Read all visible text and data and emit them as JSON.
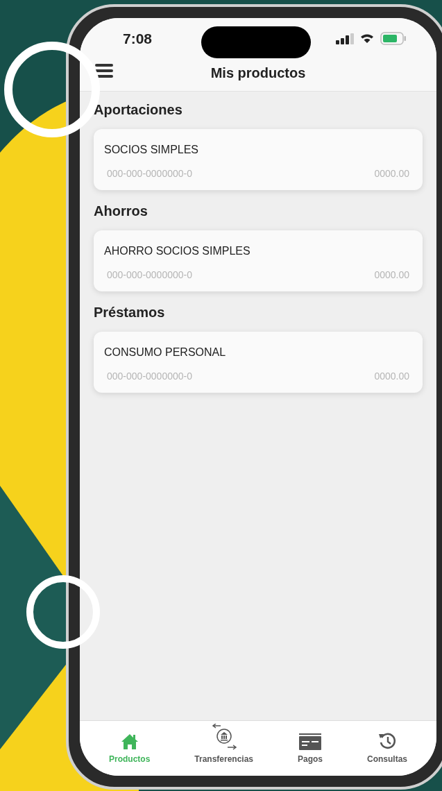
{
  "status_bar": {
    "time": "7:08"
  },
  "header": {
    "title": "Mis productos"
  },
  "sections": [
    {
      "title": "Aportaciones",
      "products": [
        {
          "name": "SOCIOS SIMPLES",
          "account": "000-000-0000000-0",
          "balance": "0000.00"
        }
      ]
    },
    {
      "title": "Ahorros",
      "products": [
        {
          "name": "AHORRO SOCIOS SIMPLES",
          "account": "000-000-0000000-0",
          "balance": "0000.00"
        }
      ]
    },
    {
      "title": "Préstamos",
      "products": [
        {
          "name": "CONSUMO PERSONAL",
          "account": "000-000-0000000-0",
          "balance": "0000.00"
        }
      ]
    }
  ],
  "tabs": [
    {
      "label": "Productos",
      "kind": "home",
      "selected": true
    },
    {
      "label": "Transferencias",
      "kind": "transfer",
      "selected": false
    },
    {
      "label": "Pagos",
      "kind": "card",
      "selected": false
    },
    {
      "label": "Consultas",
      "kind": "history",
      "selected": false
    }
  ]
}
